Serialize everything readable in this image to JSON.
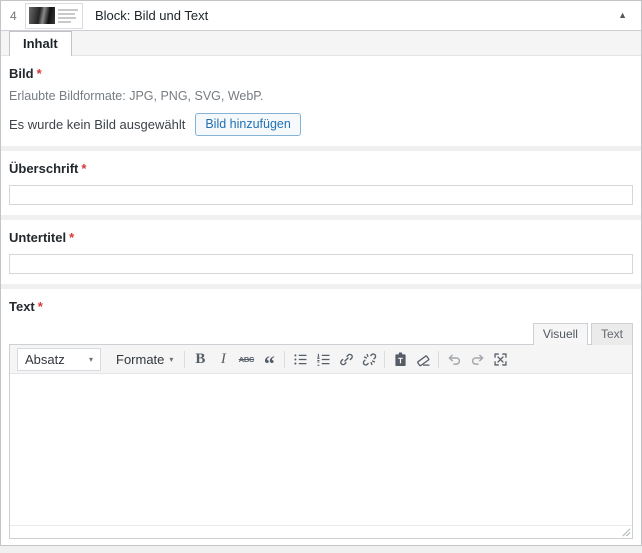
{
  "header": {
    "order": "4",
    "title": "Block: Bild und Text",
    "collapse_glyph": "▲"
  },
  "tabs": {
    "inhalt": "Inhalt"
  },
  "misc": {
    "required_mark": "*"
  },
  "fields": {
    "bild": {
      "label": "Bild",
      "description": "Erlaubte Bildformate: JPG, PNG, SVG, WebP.",
      "empty_text": "Es wurde kein Bild ausgewählt",
      "add_button": "Bild hinzufügen"
    },
    "ueberschrift": {
      "label": "Überschrift",
      "value": ""
    },
    "untertitel": {
      "label": "Untertitel",
      "value": ""
    },
    "text": {
      "label": "Text",
      "value": ""
    }
  },
  "editor": {
    "mode_visual": "Visuell",
    "mode_text": "Text",
    "toolbar": {
      "paragraph_select": "Absatz",
      "formats_button": "Formate",
      "caret": "▾",
      "bold_glyph": "B",
      "italic_glyph": "I",
      "strike_glyph": "ABC",
      "quote_glyph": "“"
    }
  },
  "colors": {
    "accent_blue": "#2271b1",
    "required_red": "#d63638",
    "toolbar_icon": "#555d66",
    "panel_border": "#c3c4c7"
  }
}
